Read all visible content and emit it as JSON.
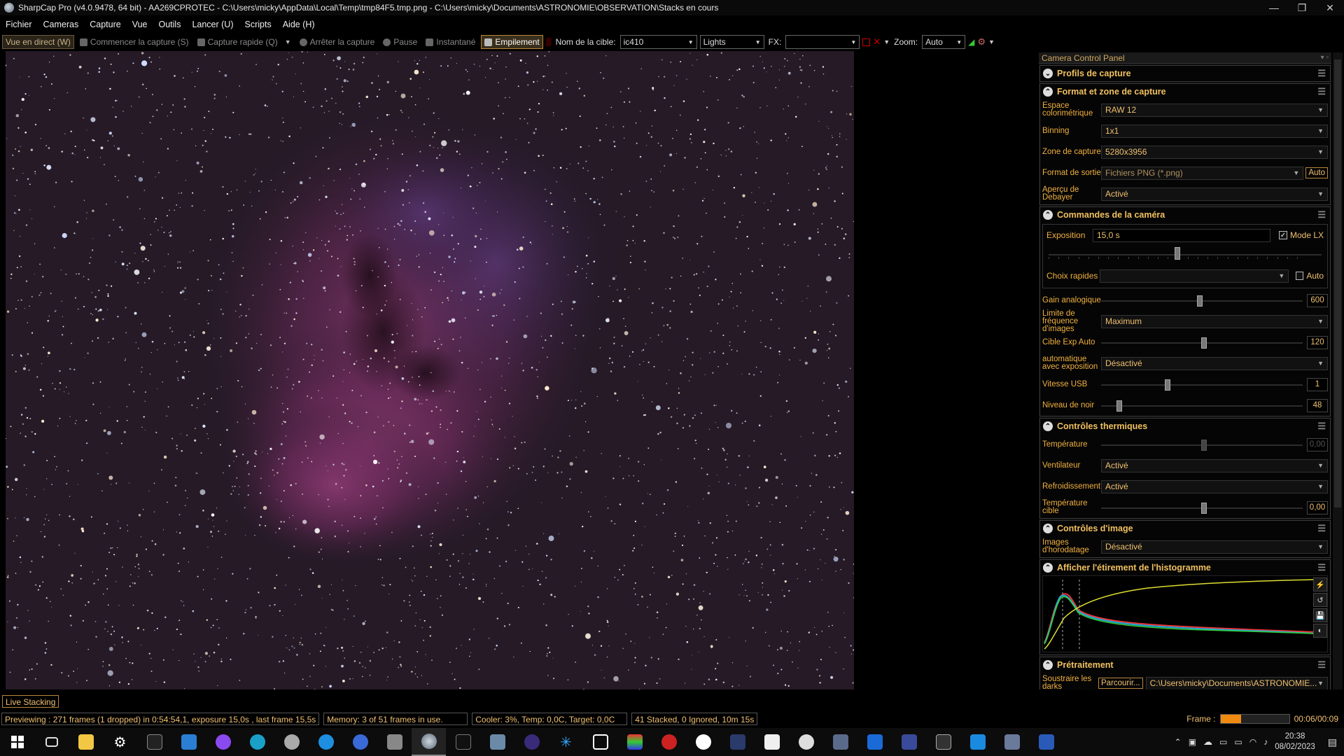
{
  "window": {
    "title": "SharpCap Pro (v4.0.9478, 64 bit) - AA269CPROTEC - C:\\Users\\micky\\AppData\\Local\\Temp\\tmp84F5.tmp.png - C:\\Users\\micky\\Documents\\ASTRONOMIE\\OBSERVATION\\Stacks en cours",
    "minimize": "—",
    "restore": "❐",
    "close": "✕"
  },
  "menu": [
    "Fichier",
    "Cameras",
    "Capture",
    "Vue",
    "Outils",
    "Lancer (U)",
    "Scripts",
    "Aide (H)"
  ],
  "toolbar": {
    "live_view": "Vue en direct (W)",
    "start_capture": "Commencer la capture (S)",
    "quick_capture": "Capture rapide (Q)",
    "stop_capture": "Arrêter la capture",
    "pause": "Pause",
    "snapshot": "Instantané",
    "stacking": "Empilement",
    "target_label": "Nom de la cible:",
    "target_value": "ic410",
    "frame_type": "Lights",
    "fx_label": "FX:",
    "fx_value": "",
    "zoom_label": "Zoom:",
    "zoom_value": "Auto"
  },
  "panel": {
    "title": "Camera Control Panel",
    "sections": {
      "profiles": "Profils de capture",
      "format": "Format et zone de capture",
      "camera": "Commandes de la caméra",
      "thermal": "Contrôles thermiques",
      "image": "Contrôles d'image",
      "histogram": "Afficher l'étirement de l'histogramme",
      "preprocess": "Prétraitement"
    },
    "format_rows": [
      {
        "label": "Espace colorimétrique",
        "value": "RAW 12"
      },
      {
        "label": "Binning",
        "value": "1x1"
      },
      {
        "label": "Zone de capture",
        "value": "5280x3956"
      },
      {
        "label": "Format de sortie",
        "value": "Fichiers PNG (*.png)",
        "extra": "Auto"
      },
      {
        "label": "Aperçu de Debayer",
        "value": "Activé"
      }
    ],
    "exposure_label": "Exposition",
    "exposure_value": "15,0 s",
    "lx_mode": "Mode LX",
    "quick_choice": "Choix rapides",
    "quick_auto": "Auto",
    "analog_gain": {
      "label": "Gain analogique",
      "value": "600",
      "level": 0.49
    },
    "frame_limit": {
      "label": "Limite de fréquence d'images",
      "value": "Maximum"
    },
    "auto_exp_target": {
      "label": "Cible Exp Auto",
      "value": "120",
      "level": 0.51
    },
    "auto_exposure": {
      "label": "automatique avec exposition",
      "value": "Désactivé"
    },
    "usb_speed": {
      "label": "Vitesse USB",
      "value": "1",
      "level": 0.33
    },
    "black_level": {
      "label": "Niveau de noir",
      "value": "48",
      "level": 0.09
    },
    "temperature": {
      "label": "Température",
      "value": "0,00",
      "level": 0.51
    },
    "fan": {
      "label": "Ventilateur",
      "value": "Activé"
    },
    "cooling": {
      "label": "Refroidissement",
      "value": "Activé"
    },
    "target_temp": {
      "label": "Température cible",
      "value": "0,00",
      "level": 0.51
    },
    "timestamp": {
      "label": "Images d'horodatage",
      "value": "Désactivé"
    },
    "darks": {
      "label": "Soustraire les darks",
      "button": "Parcourir...",
      "value": "C:\\Users\\micky\\Documents\\ASTRONOMIE..."
    }
  },
  "live_stacking_tab": "Live Stacking",
  "status": {
    "previewing": "Previewing : 271 frames (1 dropped) in 0:54:54,1, exposure 15,0s , last frame 15,5s",
    "memory": "Memory: 3 of 51 frames in use.",
    "cooler": "Cooler: 3%, Temp: 0,0C, Target: 0,0C",
    "stacked": "41 Stacked, 0 Ignored, 10m 15s",
    "frame_label": "Frame :",
    "frame_progress": 0.3,
    "frame_time": "00:06/00:09"
  },
  "taskbar": {
    "time": "20:38",
    "date": "08/02/2023",
    "icons": [
      "windows-start",
      "task-view",
      "file-explorer",
      "settings",
      "notion",
      "mail",
      "messenger",
      "edge",
      "app",
      "app",
      "app",
      "app",
      "sharpcap",
      "app",
      "app",
      "app",
      "app",
      "app",
      "app",
      "app",
      "app",
      "app",
      "app",
      "app",
      "app",
      "app",
      "app",
      "app",
      "app",
      "app",
      "app",
      "app"
    ]
  },
  "colors": {
    "accent": "#f0c060",
    "stack_border": "#b9863a",
    "nebula": "#7a3a6a"
  }
}
